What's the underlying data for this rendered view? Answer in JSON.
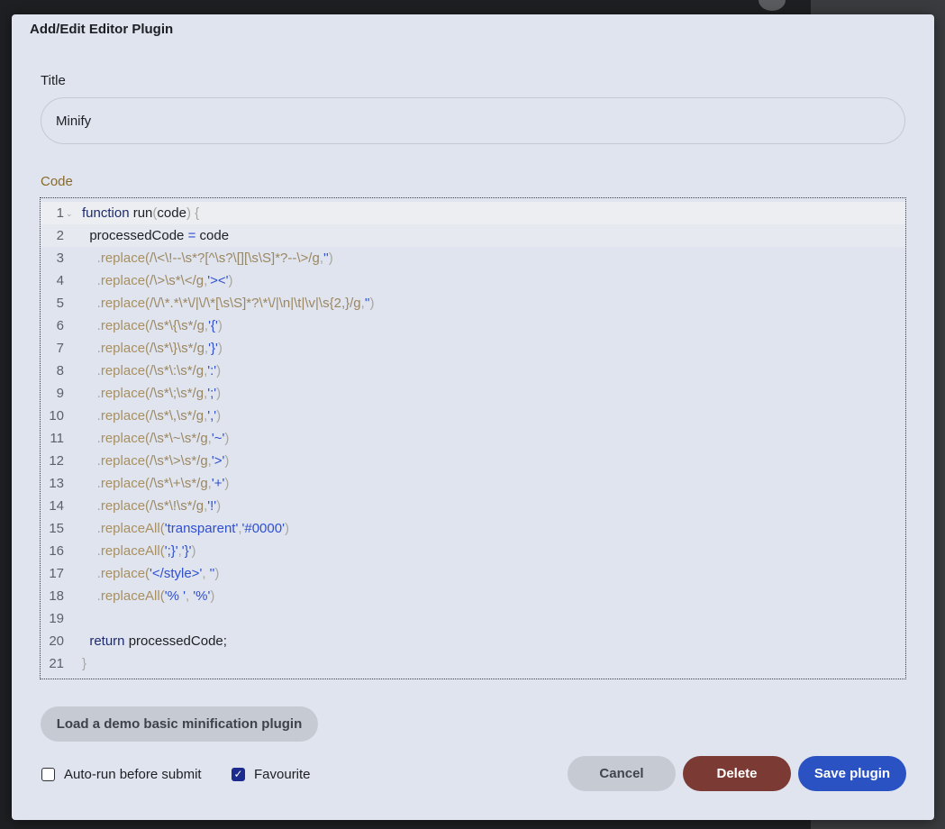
{
  "dialog": {
    "title": "Add/Edit Editor Plugin"
  },
  "form": {
    "title_label": "Title",
    "title_value": "Minify",
    "code_label": "Code"
  },
  "editor": {
    "lines": [
      {
        "number": "1",
        "tokens": [
          [
            "kw",
            "function "
          ],
          [
            "id",
            "run"
          ],
          [
            "p",
            "("
          ],
          [
            "id",
            "code"
          ],
          [
            "p",
            ") {"
          ]
        ]
      },
      {
        "number": "2",
        "tokens": [
          [
            "id",
            "  processedCode "
          ],
          [
            "op",
            "="
          ],
          [
            "id",
            " code"
          ]
        ]
      },
      {
        "number": "3",
        "tokens": [
          [
            "id",
            "    "
          ],
          [
            "p",
            "."
          ],
          [
            "mth",
            "replace("
          ],
          [
            "re",
            "/\\<\\!--\\s*?[^\\s?\\[][\\s\\S]*?--\\>/g"
          ],
          [
            "p",
            ","
          ],
          [
            "str",
            "''"
          ],
          [
            "p",
            ")"
          ]
        ]
      },
      {
        "number": "4",
        "tokens": [
          [
            "id",
            "    "
          ],
          [
            "p",
            "."
          ],
          [
            "mth",
            "replace("
          ],
          [
            "re",
            "/\\>\\s*\\</g"
          ],
          [
            "p",
            ","
          ],
          [
            "str",
            "'><'"
          ],
          [
            "p",
            ")"
          ]
        ]
      },
      {
        "number": "5",
        "tokens": [
          [
            "id",
            "    "
          ],
          [
            "p",
            "."
          ],
          [
            "mth",
            "replace("
          ],
          [
            "re",
            "/\\/\\*.*\\*\\/|\\/\\*[\\s\\S]*?\\*\\/|\\n|\\t|\\v|\\s{2,}/g"
          ],
          [
            "p",
            ","
          ],
          [
            "str",
            "''"
          ],
          [
            "p",
            ")"
          ]
        ]
      },
      {
        "number": "6",
        "tokens": [
          [
            "id",
            "    "
          ],
          [
            "p",
            "."
          ],
          [
            "mth",
            "replace("
          ],
          [
            "re",
            "/\\s*\\{\\s*/g"
          ],
          [
            "p",
            ","
          ],
          [
            "str",
            "'{'"
          ],
          [
            "p",
            ")"
          ]
        ]
      },
      {
        "number": "7",
        "tokens": [
          [
            "id",
            "    "
          ],
          [
            "p",
            "."
          ],
          [
            "mth",
            "replace("
          ],
          [
            "re",
            "/\\s*\\}\\s*/g"
          ],
          [
            "p",
            ","
          ],
          [
            "str",
            "'}'"
          ],
          [
            "p",
            ")"
          ]
        ]
      },
      {
        "number": "8",
        "tokens": [
          [
            "id",
            "    "
          ],
          [
            "p",
            "."
          ],
          [
            "mth",
            "replace("
          ],
          [
            "re",
            "/\\s*\\:\\s*/g"
          ],
          [
            "p",
            ","
          ],
          [
            "str",
            "':'"
          ],
          [
            "p",
            ")"
          ]
        ]
      },
      {
        "number": "9",
        "tokens": [
          [
            "id",
            "    "
          ],
          [
            "p",
            "."
          ],
          [
            "mth",
            "replace("
          ],
          [
            "re",
            "/\\s*\\;\\s*/g"
          ],
          [
            "p",
            ","
          ],
          [
            "str",
            "';'"
          ],
          [
            "p",
            ")"
          ]
        ]
      },
      {
        "number": "10",
        "tokens": [
          [
            "id",
            "    "
          ],
          [
            "p",
            "."
          ],
          [
            "mth",
            "replace("
          ],
          [
            "re",
            "/\\s*\\,\\s*/g"
          ],
          [
            "p",
            ","
          ],
          [
            "str",
            "','"
          ],
          [
            "p",
            ")"
          ]
        ]
      },
      {
        "number": "11",
        "tokens": [
          [
            "id",
            "    "
          ],
          [
            "p",
            "."
          ],
          [
            "mth",
            "replace("
          ],
          [
            "re",
            "/\\s*\\~\\s*/g"
          ],
          [
            "p",
            ","
          ],
          [
            "str",
            "'~'"
          ],
          [
            "p",
            ")"
          ]
        ]
      },
      {
        "number": "12",
        "tokens": [
          [
            "id",
            "    "
          ],
          [
            "p",
            "."
          ],
          [
            "mth",
            "replace("
          ],
          [
            "re",
            "/\\s*\\>\\s*/g"
          ],
          [
            "p",
            ","
          ],
          [
            "str",
            "'>'"
          ],
          [
            "p",
            ")"
          ]
        ]
      },
      {
        "number": "13",
        "tokens": [
          [
            "id",
            "    "
          ],
          [
            "p",
            "."
          ],
          [
            "mth",
            "replace("
          ],
          [
            "re",
            "/\\s*\\+\\s*/g"
          ],
          [
            "p",
            ","
          ],
          [
            "str",
            "'+'"
          ],
          [
            "p",
            ")"
          ]
        ]
      },
      {
        "number": "14",
        "tokens": [
          [
            "id",
            "    "
          ],
          [
            "p",
            "."
          ],
          [
            "mth",
            "replace("
          ],
          [
            "re",
            "/\\s*\\!\\s*/g"
          ],
          [
            "p",
            ","
          ],
          [
            "str",
            "'!'"
          ],
          [
            "p",
            ")"
          ]
        ]
      },
      {
        "number": "15",
        "tokens": [
          [
            "id",
            "    "
          ],
          [
            "p",
            "."
          ],
          [
            "mth",
            "replaceAll("
          ],
          [
            "str",
            "'transparent'"
          ],
          [
            "p",
            ","
          ],
          [
            "str",
            "'#0000'"
          ],
          [
            "p",
            ")"
          ]
        ]
      },
      {
        "number": "16",
        "tokens": [
          [
            "id",
            "    "
          ],
          [
            "p",
            "."
          ],
          [
            "mth",
            "replaceAll("
          ],
          [
            "str",
            "';}'"
          ],
          [
            "p",
            ","
          ],
          [
            "str",
            "'}'"
          ],
          [
            "p",
            ")"
          ]
        ]
      },
      {
        "number": "17",
        "tokens": [
          [
            "id",
            "    "
          ],
          [
            "p",
            "."
          ],
          [
            "mth",
            "replace("
          ],
          [
            "str",
            "'</style>'"
          ],
          [
            "p",
            ", "
          ],
          [
            "str",
            "''"
          ],
          [
            "p",
            ")"
          ]
        ]
      },
      {
        "number": "18",
        "tokens": [
          [
            "id",
            "    "
          ],
          [
            "p",
            "."
          ],
          [
            "mth",
            "replaceAll("
          ],
          [
            "str",
            "'% '"
          ],
          [
            "p",
            ", "
          ],
          [
            "str",
            "'%'"
          ],
          [
            "p",
            ")"
          ]
        ]
      },
      {
        "number": "19",
        "tokens": []
      },
      {
        "number": "20",
        "tokens": [
          [
            "kw",
            "  return "
          ],
          [
            "id",
            "processedCode;"
          ]
        ]
      },
      {
        "number": "21",
        "tokens": [
          [
            "p",
            "}"
          ]
        ]
      }
    ]
  },
  "actions": {
    "demo_label": "Load a demo basic minification plugin",
    "autorun_label": "Auto-run before submit",
    "autorun_checked": false,
    "favourite_label": "Favourite",
    "favourite_checked": true,
    "cancel_label": "Cancel",
    "delete_label": "Delete",
    "save_label": "Save plugin"
  },
  "icons": {
    "fold": "chevron-down-icon",
    "checkmark": "check-icon"
  },
  "colors": {
    "accent": "#2b52c2",
    "danger": "#7b3a34",
    "keyword": "#1d2b6e",
    "string": "#2e4fd0",
    "regex": "#9a8762"
  }
}
